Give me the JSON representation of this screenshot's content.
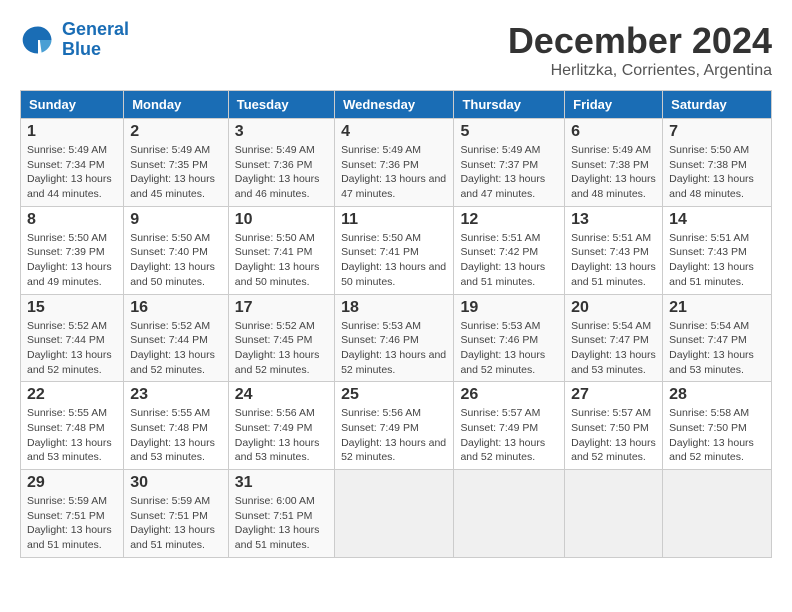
{
  "header": {
    "logo_line1": "General",
    "logo_line2": "Blue",
    "main_title": "December 2024",
    "subtitle": "Herlitzka, Corrientes, Argentina"
  },
  "calendar": {
    "days_of_week": [
      "Sunday",
      "Monday",
      "Tuesday",
      "Wednesday",
      "Thursday",
      "Friday",
      "Saturday"
    ],
    "weeks": [
      [
        {
          "day": "1",
          "sunrise": "5:49 AM",
          "sunset": "7:34 PM",
          "daylight": "13 hours and 44 minutes."
        },
        {
          "day": "2",
          "sunrise": "5:49 AM",
          "sunset": "7:35 PM",
          "daylight": "13 hours and 45 minutes."
        },
        {
          "day": "3",
          "sunrise": "5:49 AM",
          "sunset": "7:36 PM",
          "daylight": "13 hours and 46 minutes."
        },
        {
          "day": "4",
          "sunrise": "5:49 AM",
          "sunset": "7:36 PM",
          "daylight": "13 hours and 47 minutes."
        },
        {
          "day": "5",
          "sunrise": "5:49 AM",
          "sunset": "7:37 PM",
          "daylight": "13 hours and 47 minutes."
        },
        {
          "day": "6",
          "sunrise": "5:49 AM",
          "sunset": "7:38 PM",
          "daylight": "13 hours and 48 minutes."
        },
        {
          "day": "7",
          "sunrise": "5:50 AM",
          "sunset": "7:38 PM",
          "daylight": "13 hours and 48 minutes."
        }
      ],
      [
        {
          "day": "8",
          "sunrise": "5:50 AM",
          "sunset": "7:39 PM",
          "daylight": "13 hours and 49 minutes."
        },
        {
          "day": "9",
          "sunrise": "5:50 AM",
          "sunset": "7:40 PM",
          "daylight": "13 hours and 50 minutes."
        },
        {
          "day": "10",
          "sunrise": "5:50 AM",
          "sunset": "7:41 PM",
          "daylight": "13 hours and 50 minutes."
        },
        {
          "day": "11",
          "sunrise": "5:50 AM",
          "sunset": "7:41 PM",
          "daylight": "13 hours and 50 minutes."
        },
        {
          "day": "12",
          "sunrise": "5:51 AM",
          "sunset": "7:42 PM",
          "daylight": "13 hours and 51 minutes."
        },
        {
          "day": "13",
          "sunrise": "5:51 AM",
          "sunset": "7:43 PM",
          "daylight": "13 hours and 51 minutes."
        },
        {
          "day": "14",
          "sunrise": "5:51 AM",
          "sunset": "7:43 PM",
          "daylight": "13 hours and 51 minutes."
        }
      ],
      [
        {
          "day": "15",
          "sunrise": "5:52 AM",
          "sunset": "7:44 PM",
          "daylight": "13 hours and 52 minutes."
        },
        {
          "day": "16",
          "sunrise": "5:52 AM",
          "sunset": "7:44 PM",
          "daylight": "13 hours and 52 minutes."
        },
        {
          "day": "17",
          "sunrise": "5:52 AM",
          "sunset": "7:45 PM",
          "daylight": "13 hours and 52 minutes."
        },
        {
          "day": "18",
          "sunrise": "5:53 AM",
          "sunset": "7:46 PM",
          "daylight": "13 hours and 52 minutes."
        },
        {
          "day": "19",
          "sunrise": "5:53 AM",
          "sunset": "7:46 PM",
          "daylight": "13 hours and 52 minutes."
        },
        {
          "day": "20",
          "sunrise": "5:54 AM",
          "sunset": "7:47 PM",
          "daylight": "13 hours and 53 minutes."
        },
        {
          "day": "21",
          "sunrise": "5:54 AM",
          "sunset": "7:47 PM",
          "daylight": "13 hours and 53 minutes."
        }
      ],
      [
        {
          "day": "22",
          "sunrise": "5:55 AM",
          "sunset": "7:48 PM",
          "daylight": "13 hours and 53 minutes."
        },
        {
          "day": "23",
          "sunrise": "5:55 AM",
          "sunset": "7:48 PM",
          "daylight": "13 hours and 53 minutes."
        },
        {
          "day": "24",
          "sunrise": "5:56 AM",
          "sunset": "7:49 PM",
          "daylight": "13 hours and 53 minutes."
        },
        {
          "day": "25",
          "sunrise": "5:56 AM",
          "sunset": "7:49 PM",
          "daylight": "13 hours and 52 minutes."
        },
        {
          "day": "26",
          "sunrise": "5:57 AM",
          "sunset": "7:49 PM",
          "daylight": "13 hours and 52 minutes."
        },
        {
          "day": "27",
          "sunrise": "5:57 AM",
          "sunset": "7:50 PM",
          "daylight": "13 hours and 52 minutes."
        },
        {
          "day": "28",
          "sunrise": "5:58 AM",
          "sunset": "7:50 PM",
          "daylight": "13 hours and 52 minutes."
        }
      ],
      [
        {
          "day": "29",
          "sunrise": "5:59 AM",
          "sunset": "7:51 PM",
          "daylight": "13 hours and 51 minutes."
        },
        {
          "day": "30",
          "sunrise": "5:59 AM",
          "sunset": "7:51 PM",
          "daylight": "13 hours and 51 minutes."
        },
        {
          "day": "31",
          "sunrise": "6:00 AM",
          "sunset": "7:51 PM",
          "daylight": "13 hours and 51 minutes."
        },
        null,
        null,
        null,
        null
      ]
    ]
  }
}
